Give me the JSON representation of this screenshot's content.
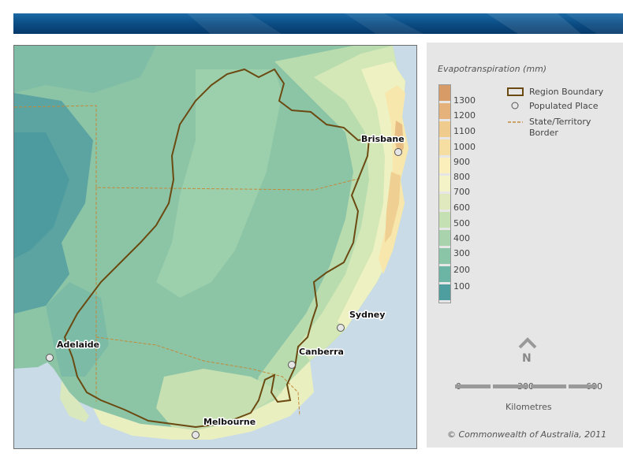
{
  "legend": {
    "title": "Evapotranspiration (mm)",
    "ramp_colors": [
      "#d79b67",
      "#e6b27b",
      "#f0cb8e",
      "#f6dea2",
      "#fbefbb",
      "#f4f3c7",
      "#dfe9bd",
      "#c5e0b2",
      "#a9d3ac",
      "#8bc5a8",
      "#6cb4a4",
      "#4e9ea0"
    ],
    "ticks": [
      "1300",
      "1200",
      "1100",
      "1000",
      "900",
      "800",
      "700",
      "600",
      "500",
      "400",
      "300",
      "200",
      "100"
    ],
    "items": {
      "region_boundary": "Region Boundary",
      "populated_place": "Populated Place",
      "state_border_line1": "State/Territory",
      "state_border_line2": "Border"
    }
  },
  "places": [
    "Brisbane",
    "Sydney",
    "Canberra",
    "Adelaide",
    "Melbourne"
  ],
  "north_label": "N",
  "scale": {
    "labels": [
      "0",
      "300",
      "600"
    ],
    "unit": "Kilometres"
  },
  "copyright": "© Commonwealth of Australia, 2011",
  "colors": {
    "region_boundary": "#6b4a12",
    "state_border": "#c28a3a",
    "ocean": "#c9dbe6",
    "banner": "#0c4f87"
  }
}
